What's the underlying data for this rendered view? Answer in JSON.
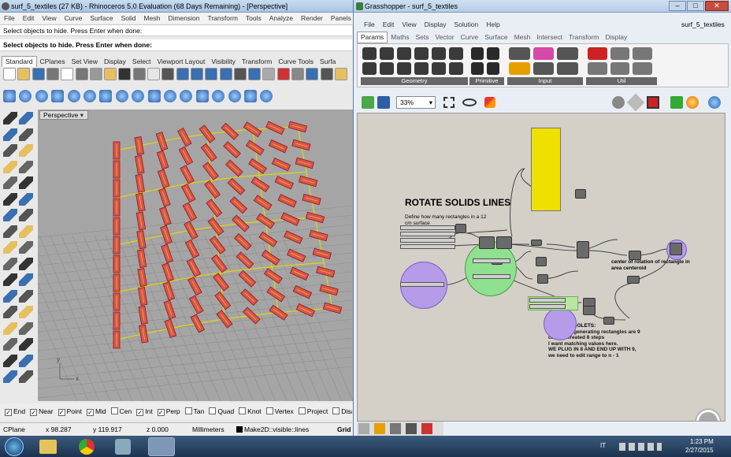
{
  "rhino": {
    "title": "surf_5_textiles (27 KB) - Rhinoceros 5.0 Evaluation (68 Days Remaining) - [Perspective]",
    "menu": [
      "File",
      "Edit",
      "View",
      "Curve",
      "Surface",
      "Solid",
      "Mesh",
      "Dimension",
      "Transform",
      "Tools",
      "Analyze",
      "Render",
      "Panels"
    ],
    "command_history": "Select objects to hide. Press Enter when done:",
    "command_prompt": "Select objects to hide. Press Enter when done:",
    "toolbar_tabs": [
      "Standard",
      "CPlanes",
      "Set View",
      "Display",
      "Select",
      "Viewport Layout",
      "Visibility",
      "Transform",
      "Curve Tools",
      "Surfa"
    ],
    "viewport_label": "Perspective",
    "osnaps": [
      {
        "label": "End",
        "checked": true
      },
      {
        "label": "Near",
        "checked": true
      },
      {
        "label": "Point",
        "checked": true
      },
      {
        "label": "Mid",
        "checked": true
      },
      {
        "label": "Cen",
        "checked": false
      },
      {
        "label": "Int",
        "checked": true
      },
      {
        "label": "Perp",
        "checked": true
      },
      {
        "label": "Tan",
        "checked": false
      },
      {
        "label": "Quad",
        "checked": false
      },
      {
        "label": "Knot",
        "checked": false
      },
      {
        "label": "Vertex",
        "checked": false
      },
      {
        "label": "Project",
        "checked": false
      },
      {
        "label": "Disa",
        "checked": false
      }
    ],
    "status": {
      "cplane": "CPlane",
      "x": "x 98.287",
      "y": "y 119.917",
      "z": "z 0.000",
      "units": "Millimeters",
      "layer": "Make2D::visible::lines",
      "grid": "Grid"
    },
    "axis_x": "x",
    "axis_y": "y"
  },
  "grasshopper": {
    "title": "Grasshopper - surf_5_textiles",
    "menu": [
      "File",
      "Edit",
      "View",
      "Display",
      "Solution",
      "Help"
    ],
    "doc_name": "surf_5_textiles",
    "tabs": [
      "Params",
      "Maths",
      "Sets",
      "Vector",
      "Curve",
      "Surface",
      "Mesh",
      "Intersect",
      "Transform",
      "Display"
    ],
    "active_tab": "Params",
    "panels": [
      "Geometry",
      "Primitive",
      "Input",
      "Util"
    ],
    "zoom": "33%",
    "canvas_title": "ROTATE SOLIDS LINES",
    "note1": "Define how many rectangles in a 12 cm surface",
    "note2": "center of rotation of rectangle in area centeroid",
    "note3_lines": [
      "LOOK AT VIOLETS:",
      "My points generating rectangles are 9",
      "cause I created 8 steps",
      "I want matching values here.",
      "WE PLUG IN 8 AND END UP WITH 9,",
      "we need to edit range to n - 1"
    ]
  },
  "taskbar": {
    "lang": "IT",
    "time": "1:23 PM",
    "date": "2/27/2015"
  },
  "colors": {
    "rhino_bg": "#a5a5a5",
    "grid": "#8d8d8d",
    "rect_fill": "#d9534f",
    "rect_edge": "#8b1a1a",
    "yellow": "#f0e000",
    "gh_canvas": "#d4d0c8",
    "violet": "#b59be8",
    "green": "#8fe08f"
  }
}
